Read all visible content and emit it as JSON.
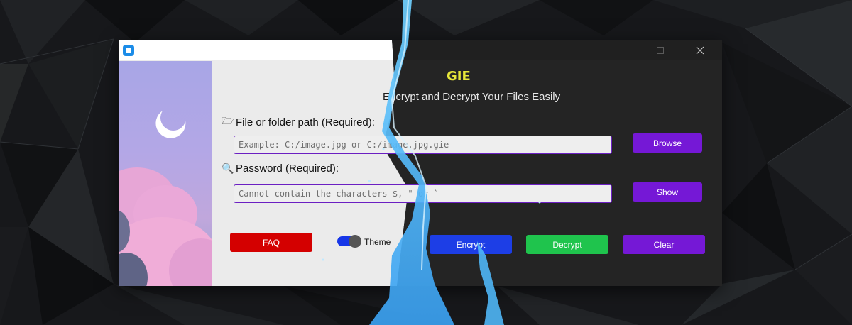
{
  "app": {
    "icon": "app-logo-icon",
    "title": "GIE",
    "subtitle_left": "E",
    "subtitle_right": "ncrypt and Decrypt Your Files Easily"
  },
  "window_controls": [
    "minimize-icon",
    "maximize-icon",
    "close-icon"
  ],
  "file": {
    "icon": "folder-icon",
    "label": "File or folder path (Required):",
    "placeholder": "Example: C:/image.jpg or C:/image.jpg.gie",
    "browse_label": "Browse"
  },
  "password": {
    "icon": "key-icon",
    "label": "Password (Required):",
    "placeholder": "Cannot contain the characters $, \" or `",
    "show_label": "Show"
  },
  "actions": {
    "faq_label": "FAQ",
    "theme_label": "Theme",
    "theme_toggle_on": true,
    "encrypt_label": "Encrypt",
    "decrypt_label": "Decrypt",
    "clear_label": "Clear"
  },
  "colors": {
    "accent_purple": "#7518d6",
    "faq_red": "#d40000",
    "encrypt_blue": "#1d3ee6",
    "decrypt_green": "#1fc44d",
    "title_yellow": "#e6e63a",
    "light_bg": "#ebebeb",
    "dark_bg": "#242424"
  }
}
